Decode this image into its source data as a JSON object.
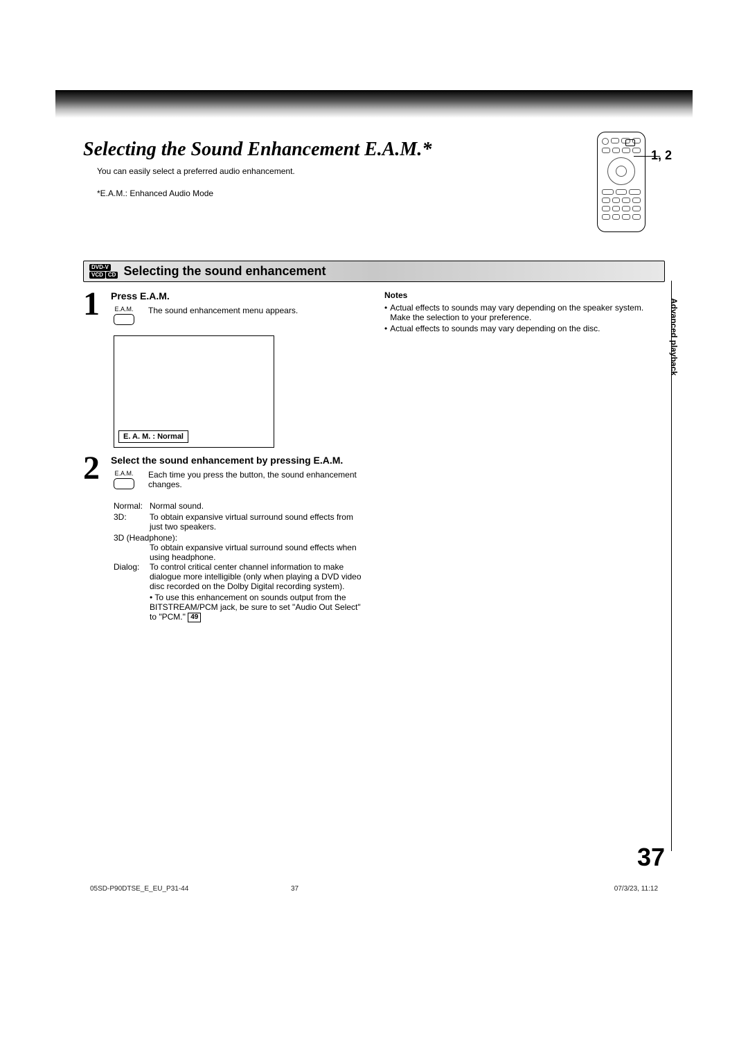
{
  "header": {
    "title": "Selecting the Sound Enhancement E.A.M.*",
    "remote_label": "1, 2",
    "intro": "You can easily select a preferred audio enhancement.",
    "note": "*E.A.M.: Enhanced Audio Mode"
  },
  "section": {
    "tags": {
      "dvdv": "DVD-V",
      "vcd": "VCD",
      "cd": "CD"
    },
    "title": "Selecting the sound enhancement"
  },
  "step1": {
    "num": "1",
    "title": "Press E.A.M.",
    "button": "E.A.M.",
    "desc": "The sound enhancement menu appears.",
    "osd": "E. A. M. : Normal"
  },
  "step2": {
    "num": "2",
    "title": "Select the sound enhancement by pressing E.A.M.",
    "button": "E.A.M.",
    "desc": "Each time you press the button, the sound enhancement changes."
  },
  "modes": {
    "normal": {
      "label": "Normal:",
      "desc": "Normal sound."
    },
    "threed": {
      "label": "3D:",
      "desc": "To obtain expansive virtual surround sound effects from just two speakers."
    },
    "hp": {
      "label": "3D (Headphone):",
      "desc": "To obtain expansive virtual surround sound effects when using headphone."
    },
    "dialog": {
      "label": "Dialog:",
      "desc": "To control critical center channel information to make dialogue more intelligible (only when playing a DVD video disc recorded on the Dolby Digital recording system)."
    },
    "bullet_pre": "• To use this enhancement on sounds output from the BITSTREAM/PCM jack, be sure to set \"Audio Out Select\" to \"PCM.\"",
    "page_ref": "49"
  },
  "notes": {
    "title": "Notes",
    "n1": "Actual effects to sounds may vary depending on the speaker system.  Make the selection to your preference.",
    "n2": "Actual effects to sounds may vary depending on the disc."
  },
  "side_tab": "Advanced playback",
  "page_number": "37",
  "footer": {
    "left": "05SD-P90DTSE_E_EU_P31-44",
    "mid": "37",
    "right": "07/3/23, 11:12"
  }
}
